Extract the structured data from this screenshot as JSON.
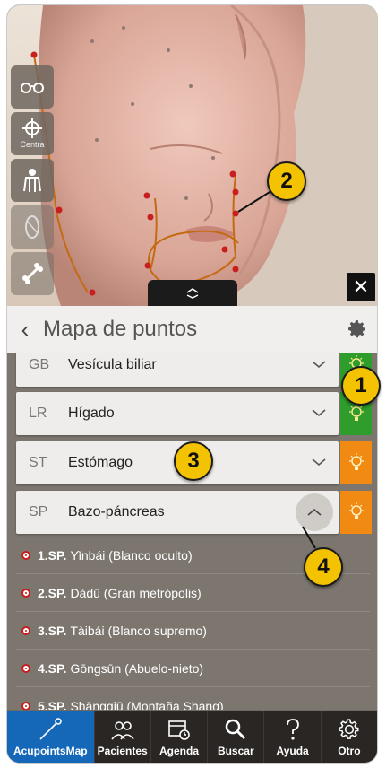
{
  "viewer": {
    "tools": [
      {
        "icon": "glasses-icon",
        "label": ""
      },
      {
        "icon": "crosshair-icon",
        "label": "Centra"
      },
      {
        "icon": "body-icon",
        "label": ""
      },
      {
        "icon": "muscle-icon",
        "label": ""
      },
      {
        "icon": "bone-icon",
        "label": ""
      }
    ],
    "close_label": "✕"
  },
  "header": {
    "title": "Mapa de puntos",
    "back_label": "‹"
  },
  "meridians": [
    {
      "code": "GB",
      "name": "Vesícula biliar",
      "expanded": false,
      "bulb_color": "#2e9d2b"
    },
    {
      "code": "LR",
      "name": "Hígado",
      "expanded": false,
      "bulb_color": "#2e9d2b"
    },
    {
      "code": "ST",
      "name": "Estómago",
      "expanded": false,
      "bulb_color": "#f08a12"
    },
    {
      "code": "SP",
      "name": "Bazo-páncreas",
      "expanded": true,
      "bulb_color": "#f08a12"
    }
  ],
  "points": [
    {
      "id": "1.SP.",
      "name": "Yǐnbái (Blanco oculto)"
    },
    {
      "id": "2.SP.",
      "name": "Dàdū (Gran metrópolis)"
    },
    {
      "id": "3.SP.",
      "name": "Tàibái (Blanco supremo)"
    },
    {
      "id": "4.SP.",
      "name": "Gōngsūn (Abuelo-nieto)"
    },
    {
      "id": "5.SP.",
      "name": "Shāngqiū (Montaña Shang)"
    }
  ],
  "badges": [
    "1",
    "2",
    "3",
    "4"
  ],
  "tabs": [
    {
      "label": "AcupointsMap",
      "icon": "needle-icon",
      "active": true
    },
    {
      "label": "Pacientes",
      "icon": "patients-icon",
      "active": false
    },
    {
      "label": "Agenda",
      "icon": "calendar-icon",
      "active": false
    },
    {
      "label": "Buscar",
      "icon": "search-icon",
      "active": false
    },
    {
      "label": "Ayuda",
      "icon": "help-icon",
      "active": false
    },
    {
      "label": "Otro",
      "icon": "gear-icon",
      "active": false
    }
  ],
  "colors": {
    "accent": "#1567b8",
    "green": "#2e9d2b",
    "orange": "#f08a12",
    "badge": "#f3c200",
    "point_red": "#c81e1e"
  }
}
